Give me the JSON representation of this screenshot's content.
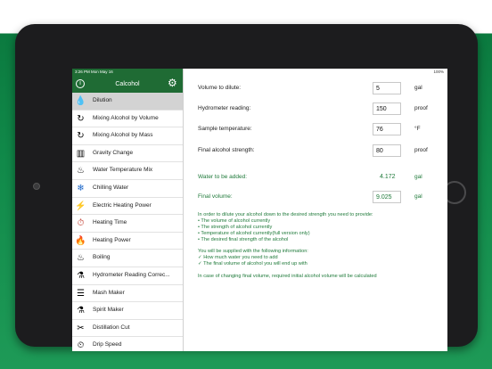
{
  "status": {
    "time": "3:26 PM  Mon May 16",
    "battery": "100%"
  },
  "sidebar": {
    "title": "Calcohol",
    "items": [
      {
        "label": "Dilution",
        "icon": "💧"
      },
      {
        "label": "Mixing Alcohol by Volume",
        "icon": "↻"
      },
      {
        "label": "Mixing Alcohol by Mass",
        "icon": "↻"
      },
      {
        "label": "Gravity Change",
        "icon": "▥"
      },
      {
        "label": "Water Temperature Mix",
        "icon": "♨"
      },
      {
        "label": "Chilling Water",
        "icon": "❄"
      },
      {
        "label": "Electric Heating Power",
        "icon": "⚡"
      },
      {
        "label": "Heating Time",
        "icon": "⏱"
      },
      {
        "label": "Heating Power",
        "icon": "🔥"
      },
      {
        "label": "Boiling",
        "icon": "♨"
      },
      {
        "label": "Hydrometer Reading Correc...",
        "icon": "⚗"
      },
      {
        "label": "Mash Maker",
        "icon": "☰"
      },
      {
        "label": "Spirit Maker",
        "icon": "⚗"
      },
      {
        "label": "Distillation Cut",
        "icon": "✂"
      },
      {
        "label": "Drip Speed",
        "icon": "⏲"
      }
    ]
  },
  "form": {
    "volume": {
      "label": "Volume to dilute:",
      "value": "5",
      "unit": "gal"
    },
    "hydrometer": {
      "label": "Hydrometer reading:",
      "value": "150",
      "unit": "proof"
    },
    "temperature": {
      "label": "Sample temperature:",
      "value": "76",
      "unit": "°F"
    },
    "final_strength": {
      "label": "Final alcohol strength:",
      "value": "80",
      "unit": "proof"
    },
    "water": {
      "label": "Water to be added:",
      "value": "4.172",
      "unit": "gal"
    },
    "final_volume": {
      "label": "Final volume:",
      "value": "9.025",
      "unit": "gal"
    }
  },
  "info": [
    "In order to dilute your alcohol down to the desired strength you need to provide:",
    "• The volume of alcohol currently",
    "• The strength of alcohol currently",
    "• Temperature of alcohol currently(full version only)",
    "• The desired final strength of the alcohol",
    "",
    "You will be supplied with the following information:",
    "✓ How much water you need to add",
    "✓ The final volume of alcohol you will end up with",
    "",
    "In case of changing final volume, required initial alcohol volume will be calculated"
  ],
  "colors": {
    "header": "#1f6b34",
    "accent": "#1f7a3a",
    "background": "#118a4a"
  }
}
